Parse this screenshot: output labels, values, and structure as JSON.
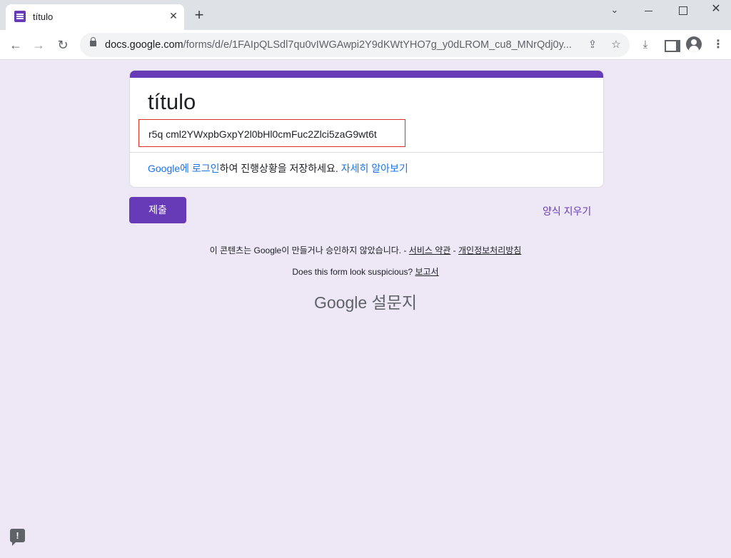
{
  "browser": {
    "tab_title": "título",
    "tab_close": "✕",
    "new_tab": "+",
    "window_chevron": "⌄",
    "window_close": "✕",
    "url_host": "docs.google.com",
    "url_path": "/forms/d/e/1FAIpQLSdl7qu0vIWGAwpi2Y9dKWtYHO7g_y0dLROM_cu8_MNrQdj0y...",
    "back_glyph": "←",
    "forward_glyph": "→",
    "reload_glyph": "↻",
    "icons": [
      "lock-icon",
      "share-icon",
      "star-icon",
      "download-icon",
      "side-panel-icon",
      "profile-icon",
      "menu-icon"
    ]
  },
  "form": {
    "accent_color": "#673ab7",
    "title": "título",
    "description": "r5q cml2YWxpbGxpY2l0bHl0cmFuc2Zlci5zaG9wt6t",
    "signin_google": "Google",
    "signin_login": "에 로그인",
    "signin_rest": "하여 진행상황을 저장하세요. ",
    "learn_more": "자세히 알아보기",
    "submit_label": "제출",
    "clear_label": "양식 지우기"
  },
  "footer": {
    "disclaimer_text": "이 콘텐츠는 Google이 만들거나 승인하지 않았습니다. - ",
    "terms_link": "서비스 약관",
    "separator": " - ",
    "privacy_link": "개인정보처리방침",
    "suspicious_text": "Does this form look suspicious? ",
    "report_link": "보고서",
    "brand": "Google 설문지",
    "feedback_glyph": "!"
  }
}
